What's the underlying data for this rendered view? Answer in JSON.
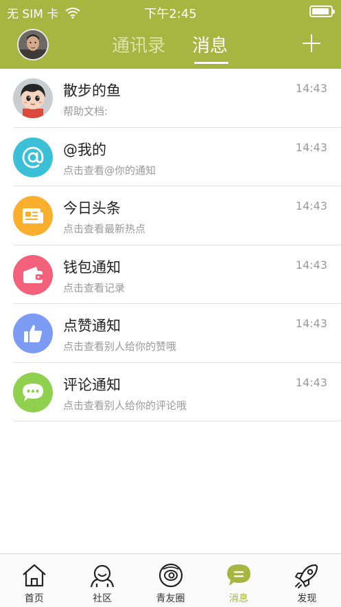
{
  "status_bar": {
    "carrier": "无 SIM 卡",
    "time": "下午2:45"
  },
  "header": {
    "tabs": [
      {
        "label": "通讯录",
        "active": false
      },
      {
        "label": "消息",
        "active": true
      }
    ],
    "add_icon": "plus-icon"
  },
  "colors": {
    "brand": "#a5b740",
    "at_mention": "#3cc0d8",
    "headlines": "#fbb02d",
    "wallet": "#f3607a",
    "likes": "#7c9cf4",
    "comments": "#8fd14f"
  },
  "messages": [
    {
      "title": "散步的鱼",
      "subtitle": "帮助文档:",
      "time": "14:43",
      "icon": "cartoon-avatar"
    },
    {
      "title": "@我的",
      "subtitle": "点击查看@你的通知",
      "time": "14:43",
      "icon": "at-icon"
    },
    {
      "title": "今日头条",
      "subtitle": "点击查看最新热点",
      "time": "14:43",
      "icon": "newspaper-icon"
    },
    {
      "title": "钱包通知",
      "subtitle": "点击查看记录",
      "time": "14:43",
      "icon": "wallet-icon"
    },
    {
      "title": "点赞通知",
      "subtitle": "点击查看别人给你的赞哦",
      "time": "14:43",
      "icon": "thumbs-up-icon"
    },
    {
      "title": "评论通知",
      "subtitle": "点击查看别人给你的评论哦",
      "time": "14:43",
      "icon": "chat-bubble-icon"
    }
  ],
  "bottom_nav": [
    {
      "label": "首页",
      "icon": "home-icon",
      "active": false
    },
    {
      "label": "社区",
      "icon": "community-icon",
      "active": false
    },
    {
      "label": "青友圈",
      "icon": "friends-circle-icon",
      "active": false
    },
    {
      "label": "消息",
      "icon": "message-icon",
      "active": true
    },
    {
      "label": "发现",
      "icon": "rocket-icon",
      "active": false
    }
  ]
}
